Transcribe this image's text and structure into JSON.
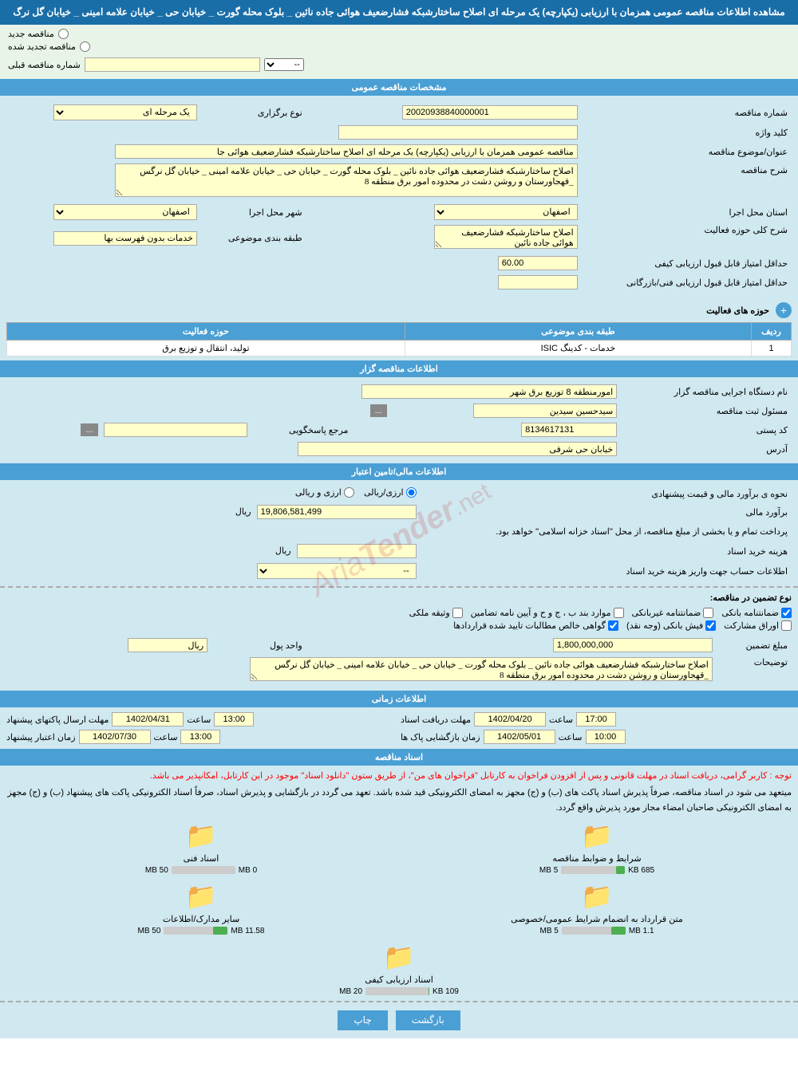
{
  "header": {
    "title": "مشاهده اطلاعات مناقصه عمومی همزمان با ارزیابی (یکپارچه) یک مرحله ای اصلاح ساختارشبکه فشارضعیف هوائی جاده نائین _ بلوک محله گورت _ خیابان حی _ خیابان علامه امینی _ خیابان گل نرگ"
  },
  "radio": {
    "new_label": "مناقصه جدید",
    "renewed_label": "مناقصه تجدید شده"
  },
  "prev_tender_label": "شماره مناقصه قبلی",
  "general_specs": {
    "section_title": "مشخصات مناقصه عمومی",
    "tender_number_label": "شماره مناقصه",
    "tender_number_value": "20020938840000001",
    "type_label": "نوع برگزاری",
    "type_value": "یک مرحله ای",
    "keyword_label": "کلید واژه",
    "keyword_value": "",
    "subject_label": "عنوان/موضوع مناقصه",
    "subject_value": "مناقصه عمومی همزمان با ارزیابی (یکپارچه) یک مرحله ای اصلاح ساختارشبکه فشارضعیف هوائی جا",
    "description_label": "شرح مناقصه",
    "description_value": "اصلاح ساختارشبکه فشارضعیف هوائی جاده نائین _ بلوک محله گورت _ خیابان حی _ خیابان علامه امینی _ خیابان گل نرگس _قهجاورستان و روشن دشت در محدوده امور برق منطقه 8",
    "province_label": "استان محل اجرا",
    "province_value": "اصفهان",
    "city_label": "شهر محل اجرا",
    "city_value": "اصفهان",
    "activity_desc_label": "شرح کلی حوزه فعالیت",
    "activity_desc_value": "اصلاح ساختارشبکه فشارضعیف هوائی جاده نائین",
    "category_label": "طبقه بندی موضوعی",
    "category_value": "خدمات بدون فهرست بها",
    "min_quality_label": "حداقل امتیاز قابل قبول ارزیابی کیفی",
    "min_quality_value": "60.00",
    "min_tech_label": "حداقل امتیاز قابل قبول ارزیابی فنی/بازرگانی",
    "min_tech_value": ""
  },
  "activity_zones": {
    "section_title": "حوزه های فعالیت",
    "add_btn_label": "+",
    "table_headers": [
      "ردیف",
      "طبقه بندی موضوعی",
      "حوزه فعالیت"
    ],
    "rows": [
      {
        "row": "1",
        "category": "خدمات - کدینگ ISIC",
        "zone": "تولید، انتقال و توزیع برق"
      }
    ]
  },
  "organizer_info": {
    "section_title": "اطلاعات مناقصه گزار",
    "exec_org_label": "نام دستگاه اجرایی مناقصه گزار",
    "exec_org_value": "امورمنطقه 8 توزیع برق شهر",
    "responsible_label": "مسئول ثبت مناقصه",
    "responsible_value": "سیدحسین سیدین",
    "postal_label": "کد پستی",
    "postal_value": "8134617131",
    "reference_label": "مرجع پاسخگویی",
    "reference_value": "",
    "address_label": "آدرس",
    "address_value": "خیابان حی شرقی",
    "btn_label": "..."
  },
  "financial_info": {
    "section_title": "اطلاعات مالی/تامین اعتبار",
    "estimation_type_label": "نحوه ی برآورد مالی و قیمت پیشنهادی",
    "option_rial": "ارزی/ریالی",
    "option_energy": "ارزی و ریالی",
    "budget_label": "برآورد مالی",
    "budget_value": "19,806,581,499",
    "budget_unit": "ریال",
    "payment_note": "پرداخت تمام و یا بخشی از مبلغ مناقصه، از محل \"اسناد خزانه اسلامی\" خواهد بود.",
    "purchase_cost_label": "هزینه خرید اسناد",
    "purchase_cost_value": "",
    "purchase_cost_unit": "ریال",
    "account_info_label": "اطلاعات حساب جهت واریز هزینه خرید اسناد",
    "account_info_value": "--"
  },
  "guarantee_info": {
    "section_title": "نوع تضمین در مناقصه",
    "guarantee_type_label": "نوع تضمین در مناقصه:",
    "types": [
      {
        "label": "ضمانتنامه بانکی",
        "checked": true
      },
      {
        "label": "ضمانتنامه غیربانکی",
        "checked": false
      },
      {
        "label": "موارد بند ب ، ج و ح و آیین نامه تضامین",
        "checked": false
      },
      {
        "label": "وثیقه ملکی",
        "checked": false
      },
      {
        "label": "اوراق مشارکت",
        "checked": false
      },
      {
        "label": "فیش بانکی (وجه نقد)",
        "checked": true
      },
      {
        "label": "گواهی خالص مطالبات تایید شده قراردادها",
        "checked": true
      }
    ],
    "amount_label": "مبلغ تضمین",
    "amount_value": "1,800,000,000",
    "unit_label": "واحد پول",
    "unit_value": "ریال",
    "description_label": "توضیحات",
    "description_value": "اصلاح ساختارشبکه فشارضعیف هوائی جاده نائین _ بلوک محله گورت _ خیابان حی _ خیابان علامه امینی _ خیابان گل نرگس _قهجاورستان و روشن دشت در محدوده امور برق منطقه 8"
  },
  "timing_info": {
    "section_title": "اطلاعات زمانی",
    "items": [
      {
        "label": "مهلت دریافت اسناد",
        "date": "1402/04/20",
        "time": "17:00",
        "date_align": "right"
      },
      {
        "label": "مهلت ارسال پاکتهای پیشنهاد",
        "date": "1402/04/31",
        "time": "13:00",
        "date_align": "right"
      },
      {
        "label": "زمان بازگشایی پاک ها",
        "date": "1402/05/01",
        "time": "10:00",
        "date_align": "right"
      },
      {
        "label": "زمان اعتبار پیشنهاد",
        "date": "1402/07/30",
        "time": "13:00",
        "date_align": "right"
      }
    ]
  },
  "tender_docs": {
    "section_title": "اسناد مناقصه",
    "notice1": "توجه : کاربر گرامی، دریافت اسناد در مهلت قانونی و پس از افزودن فراخوان به کارتابل \"فراخوان های من\"، از طریق ستون \"دانلود اسناد\" موجود در این کارتابل، امکانپذیر می باشد.",
    "notice2": "میتعهد می شود در اسناد مناقصه، صرفاً پذیرش اسناد پاکت های (ب) و (ج) مجهز به امضای الکترونیکی قید شده باشد. تعهد می گردد در بازگشایی و پذیرش اسناد، صرفاً اسناد الکترونیکی پاکت های پیشنهاد (ب) و (ج) مجهز به امضای الکترونیکی صاحبان امضاء مجاز مورد پذیرش واقع گردد.",
    "docs": [
      {
        "label": "شرایط و ضوابط مناقصه",
        "size": "685 KB",
        "max": "5 MB",
        "progress": 13.7
      },
      {
        "label": "اسناد فنی",
        "size": "0 MB",
        "max": "50 MB",
        "progress": 0
      },
      {
        "label": "متن قرارداد به انضمام شرایط عمومی/خصوصی",
        "size": "1.1 MB",
        "max": "5 MB",
        "progress": 22
      },
      {
        "label": "سایر مدارک/اطلاعات",
        "size": "11.58 MB",
        "max": "50 MB",
        "progress": 23.2
      }
    ],
    "doc_quality": {
      "label": "اسناد ارزیابی کیفی",
      "size": "109 KB",
      "max": "20 MB",
      "progress": 0.5
    }
  },
  "buttons": {
    "print_label": "چاپ",
    "back_label": "بازگشت"
  },
  "watermark": "ArialTender.net"
}
